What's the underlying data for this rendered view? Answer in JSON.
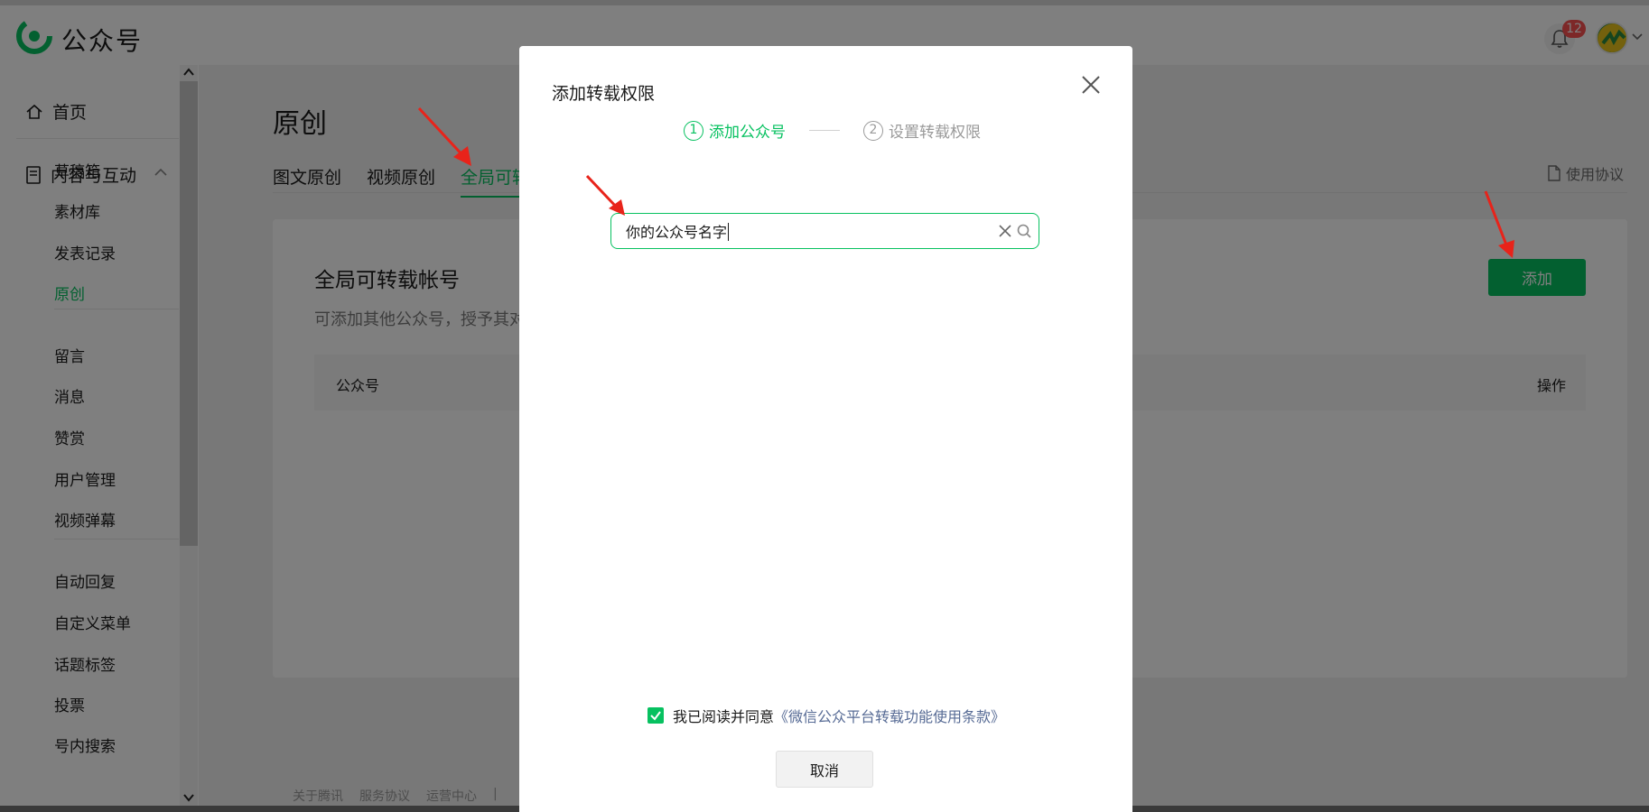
{
  "topbar": {
    "brand": "公众号",
    "notification_count": "12"
  },
  "sidebar": {
    "home": "首页",
    "group": "内容与互动",
    "items": [
      "草稿箱",
      "素材库",
      "发表记录",
      "原创",
      "留言",
      "消息",
      "赞赏",
      "用户管理",
      "视频弹幕",
      "自动回复",
      "自定义菜单",
      "话题标签",
      "投票",
      "号内搜索"
    ],
    "active": "原创"
  },
  "main": {
    "title": "原创",
    "tabs": [
      "图文原创",
      "视频原创",
      "全局可转"
    ],
    "doc_link": "使用协议",
    "card": {
      "title": "全局可转载帐号",
      "desc": "可添加其他公众号，授予其对",
      "add_label": "添加",
      "table_header_left": "公众号",
      "table_header_right": "操作"
    },
    "footer": [
      "关于腾讯",
      "服务协议",
      "运营中心",
      "|"
    ]
  },
  "modal": {
    "title": "添加转载权限",
    "step1_num": "1",
    "step1_label": "添加公众号",
    "step2_num": "2",
    "step2_label": "设置转载权限",
    "search_value": "你的公众号名字",
    "agree_text": "我已阅读并同意",
    "agree_link": "《微信公众平台转载功能使用条款》",
    "cancel_label": "取消"
  },
  "colors": {
    "accent": "#07c160",
    "link": "#576b95",
    "badge": "#fa5151"
  }
}
